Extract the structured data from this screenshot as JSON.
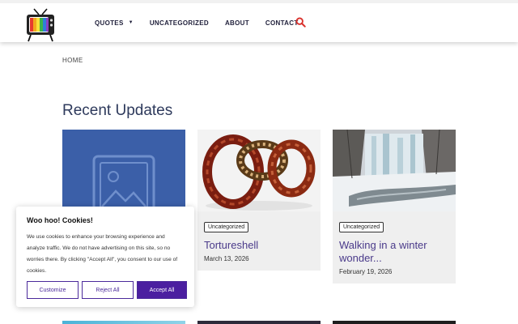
{
  "nav": {
    "items": [
      {
        "label": "QUOTES",
        "has_dropdown": true
      },
      {
        "label": "UNCATEGORIZED",
        "has_dropdown": false
      },
      {
        "label": "ABOUT",
        "has_dropdown": false
      },
      {
        "label": "CONTACT",
        "has_dropdown": false
      }
    ],
    "search_icon": "search-icon"
  },
  "breadcrumb": "HOME",
  "page_title": "Recent Updates",
  "cards": [
    {
      "thumb": "placeholder-image-icon",
      "badge": "",
      "title": "",
      "date": ""
    },
    {
      "thumb": "bracelets-photo",
      "badge": "Uncategorized",
      "title": "Tortureshell",
      "date": "March 13, 2026"
    },
    {
      "thumb": "frozen-waterfall-photo",
      "badge": "Uncategorized",
      "title": "Walking in a winter wonder...",
      "date": "February 19, 2026"
    }
  ],
  "cookie": {
    "title": "Woo hoo! Cookies!",
    "text": "We use cookies to enhance your browsing experience and analyze traffic. We do not have advertising on this site, so no worries there. By clicking \"Accept All\", you consent to our use of cookies.",
    "customize": "Customize",
    "reject": "Reject All",
    "accept": "Accept All"
  },
  "colors": {
    "accent": "#4b1fa0",
    "nav_text": "#1f1f3a",
    "title": "#2e3a5c",
    "card_title": "#4a3a8a",
    "placeholder_bg": "#3b5fa8",
    "search": "#d9302b"
  }
}
